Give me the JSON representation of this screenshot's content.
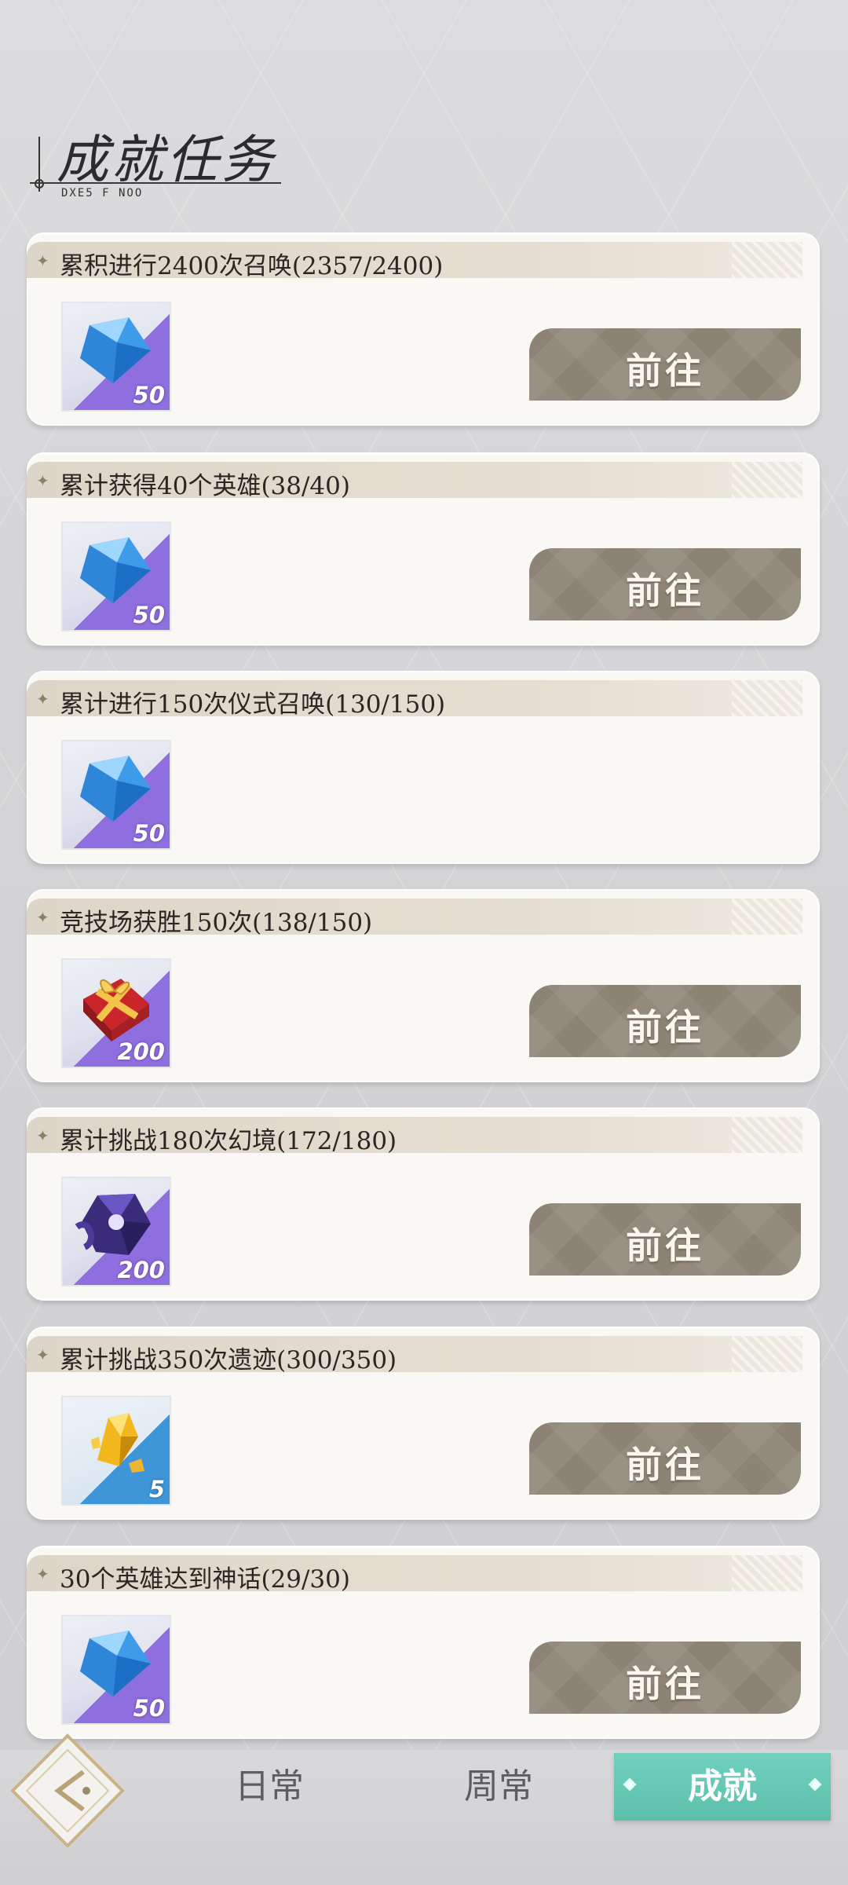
{
  "header": {
    "title": "成就任务",
    "subtitle": "DXE5 F NOO"
  },
  "tasks": [
    {
      "text": "累积进行2400次召唤(2357/2400)",
      "reward_icon": "diamond-icon",
      "reward_qty": "50",
      "button": "前往"
    },
    {
      "text": "累计获得40个英雄(38/40)",
      "reward_icon": "diamond-icon",
      "reward_qty": "50",
      "button": "前往"
    },
    {
      "text": "累计进行150次仪式召唤(130/150)",
      "reward_icon": "diamond-icon",
      "reward_qty": "50",
      "button": null
    },
    {
      "text": "竞技场获胜150次(138/150)",
      "reward_icon": "gift-box-icon",
      "reward_qty": "200",
      "button": "前往"
    },
    {
      "text": "累计挑战180次幻境(172/180)",
      "reward_icon": "purple-gem-icon",
      "reward_qty": "200",
      "button": "前往"
    },
    {
      "text": "累计挑战350次遗迹(300/350)",
      "reward_icon": "gold-crystal-icon",
      "reward_qty": "5",
      "button": "前往"
    },
    {
      "text": "30个英雄达到神话(29/30)",
      "reward_icon": "diamond-icon",
      "reward_qty": "50",
      "button": "前往"
    }
  ],
  "tabs": [
    {
      "label": "日常",
      "active": false
    },
    {
      "label": "周常",
      "active": false
    },
    {
      "label": "成就",
      "active": true
    }
  ],
  "colors": {
    "accent_tab": "#5cc0ab",
    "button_bg": "#8d8375",
    "card_bg": "#faf8f4"
  }
}
